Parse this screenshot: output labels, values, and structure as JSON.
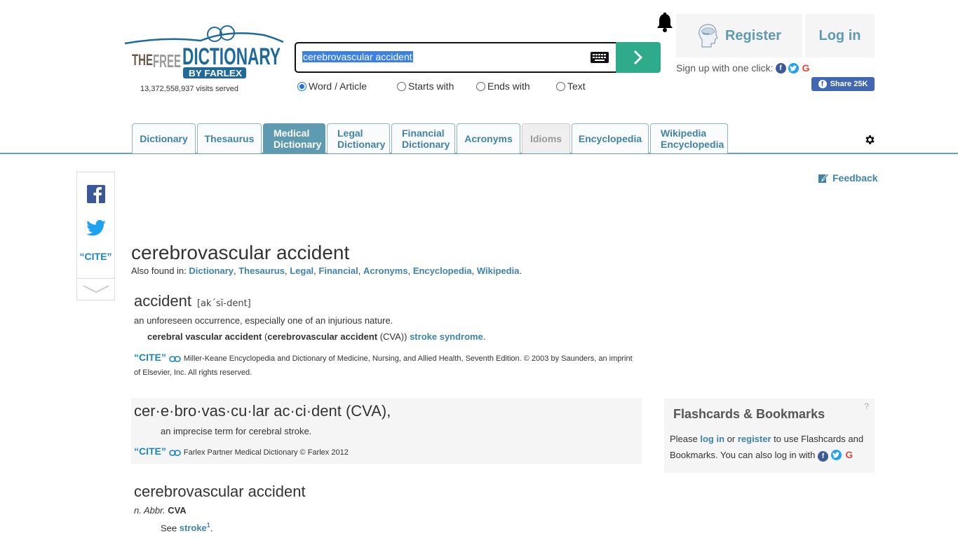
{
  "header": {
    "logo_alt": "The Free Dictionary by Farlex",
    "logo_parts": {
      "the": "THE",
      "free": "FREE",
      "dictionary": "DICTIONARY",
      "by": "BY FARLEX"
    },
    "visits": "13,372,558,937 visits served",
    "search": {
      "value": "cerebrovascular accident"
    },
    "search_modes": [
      {
        "label": "Word / Article",
        "checked": true
      },
      {
        "label": "Starts with",
        "checked": false
      },
      {
        "label": "Ends with",
        "checked": false
      },
      {
        "label": "Text",
        "checked": false
      }
    ],
    "register_label": "Register",
    "login_label": "Log in",
    "signup_text": "Sign up with one click:",
    "share_label": "Share 25K"
  },
  "tabs": [
    {
      "label": "Dictionary",
      "state": "normal"
    },
    {
      "label": "Thesaurus",
      "state": "normal"
    },
    {
      "label": "Medical\nDictionary",
      "line1": "Medical",
      "line2": "Dictionary",
      "state": "active"
    },
    {
      "label": "Legal\nDictionary",
      "line1": "Legal",
      "line2": "Dictionary",
      "state": "normal"
    },
    {
      "label": "Financial\nDictionary",
      "line1": "Financial",
      "line2": "Dictionary",
      "state": "normal"
    },
    {
      "label": "Acronyms",
      "state": "normal"
    },
    {
      "label": "Idioms",
      "state": "disabled"
    },
    {
      "label": "Encyclopedia",
      "state": "normal"
    },
    {
      "label": "Wikipedia\nEncyclopedia",
      "line1": "Wikipedia",
      "line2": "Encyclopedia",
      "state": "normal"
    }
  ],
  "sidebar": {
    "cite_label": "“CITE”"
  },
  "feedback_label": "Feedback",
  "main": {
    "title": "cerebrovascular accident",
    "also_found_label": "Also found in:",
    "also_found": [
      "Dictionary",
      "Thesaurus",
      "Legal",
      "Financial",
      "Acronyms",
      "Encyclopedia",
      "Wikipedia"
    ],
    "entries": [
      {
        "headword": "accident",
        "pronunciation": "[ak´sĭ-dent]",
        "definition": "an unforeseen occurrence, especially one of an injurious nature.",
        "sub": {
          "term": "cerebral vascular accident",
          "paren_open": " (",
          "alt_term": "cerebrovascular accident",
          "abbr": " (CVA)) ",
          "link": "stroke syndrome",
          "end": "."
        },
        "cite_label": "“CITE”",
        "source": "Miller-Keane Encyclopedia and Dictionary of Medicine, Nursing, and Allied Health, Seventh Edition. © 2003 by Saunders, an imprint of Elsevier, Inc. All rights reserved."
      },
      {
        "headword": "cer·e·bro·vas·cu·lar ac·ci·dent (CVA),",
        "definition": "an imprecise term for cerebral stroke.",
        "cite_label": "“CITE”",
        "source": "Farlex Partner Medical Dictionary © Farlex 2012"
      },
      {
        "headword": "cerebrovascular accident",
        "pos": "n. Abbr.",
        "abbr": "CVA",
        "see_label": "See",
        "see_link": "stroke",
        "see_sup": "1",
        "end": "."
      }
    ]
  },
  "flashcards": {
    "title": "Flashcards & Bookmarks",
    "help": "?",
    "text_1": "Please ",
    "login_link": "log in",
    "text_2": " or ",
    "register_link": "register",
    "text_3": " to use Flashcards and Bookmarks. You can also log in with "
  },
  "colors": {
    "accent": "#3f83a9",
    "tab_active": "#5f9bb0",
    "search_button": "#2eab8a",
    "facebook": "#3b5998",
    "twitter": "#1da1f2",
    "selection": "#3b80e6"
  }
}
